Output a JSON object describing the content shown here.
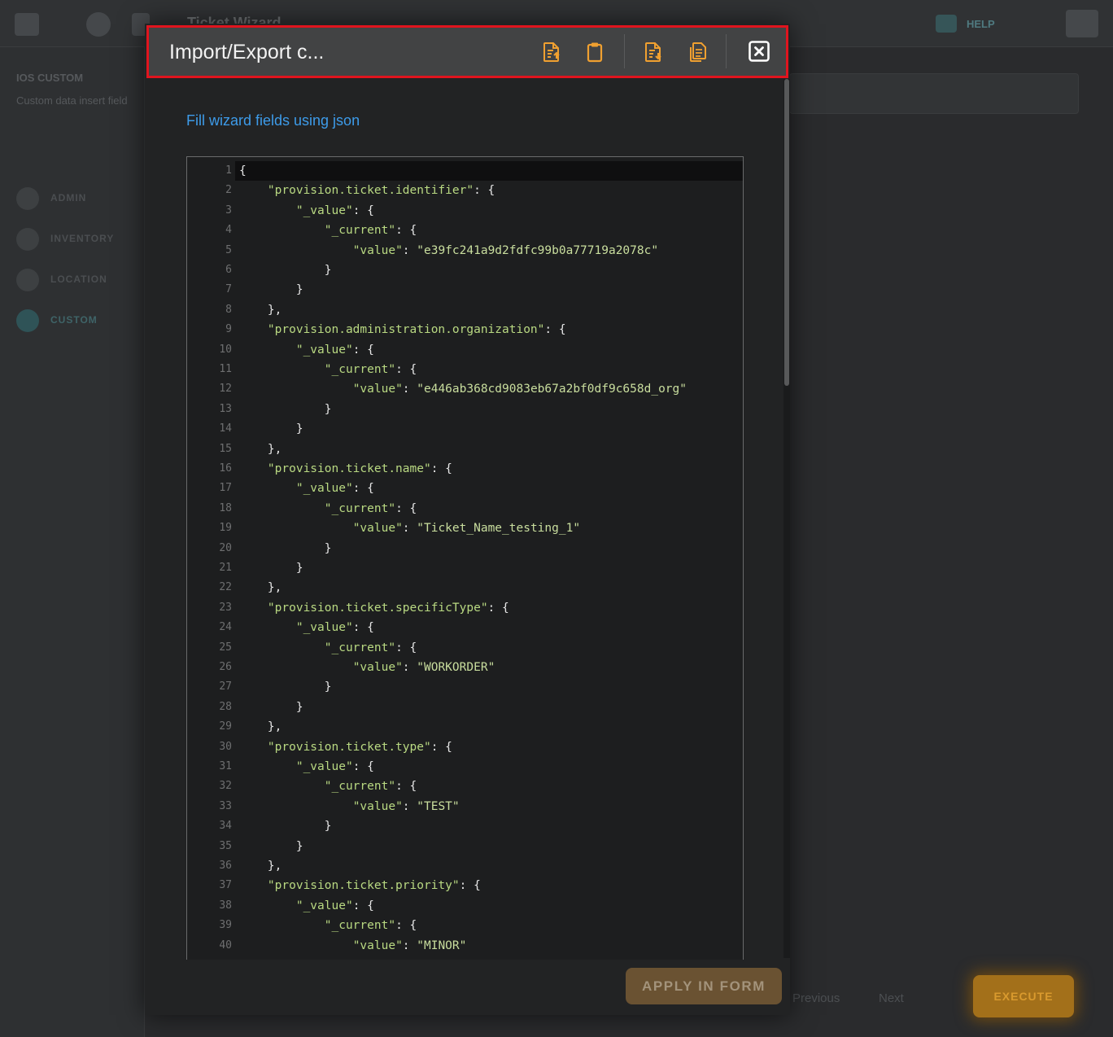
{
  "background": {
    "title": "Ticket Wizard",
    "help_label": "HELP",
    "sidebar_title": "IOS CUSTOM",
    "sidebar_desc": "Custom data insert field",
    "nav": [
      "ADMIN",
      "INVENTORY",
      "LOCATION",
      "CUSTOM"
    ],
    "footer_prev": "Previous",
    "footer_next": "Next",
    "execute_label": "EXECUTE"
  },
  "modal": {
    "title": "Import/Export c...",
    "header_icons": [
      "file-upload-icon",
      "clipboard-icon",
      "file-download-icon",
      "copy-icon",
      "close-icon"
    ],
    "subtitle": "Fill wizard fields using json",
    "apply_label": "APPLY IN FORM",
    "accent_color": "#3d9be9",
    "icon_color": "#f0a030",
    "header_border_color": "#e0141e"
  },
  "editor": {
    "entries": [
      {
        "key": "provision.ticket.identifier",
        "value": "e39fc241a9d2fdfc99b0a77719a2078c"
      },
      {
        "key": "provision.administration.organization",
        "value": "e446ab368cd9083eb67a2bf0df9c658d_org"
      },
      {
        "key": "provision.ticket.name",
        "value": "Ticket_Name_testing_1"
      },
      {
        "key": "provision.ticket.specificType",
        "value": "WORKORDER"
      },
      {
        "key": "provision.ticket.type",
        "value": "TEST"
      },
      {
        "key": "provision.ticket.priority",
        "value": "MINOR"
      }
    ],
    "visible_lines": 40
  }
}
